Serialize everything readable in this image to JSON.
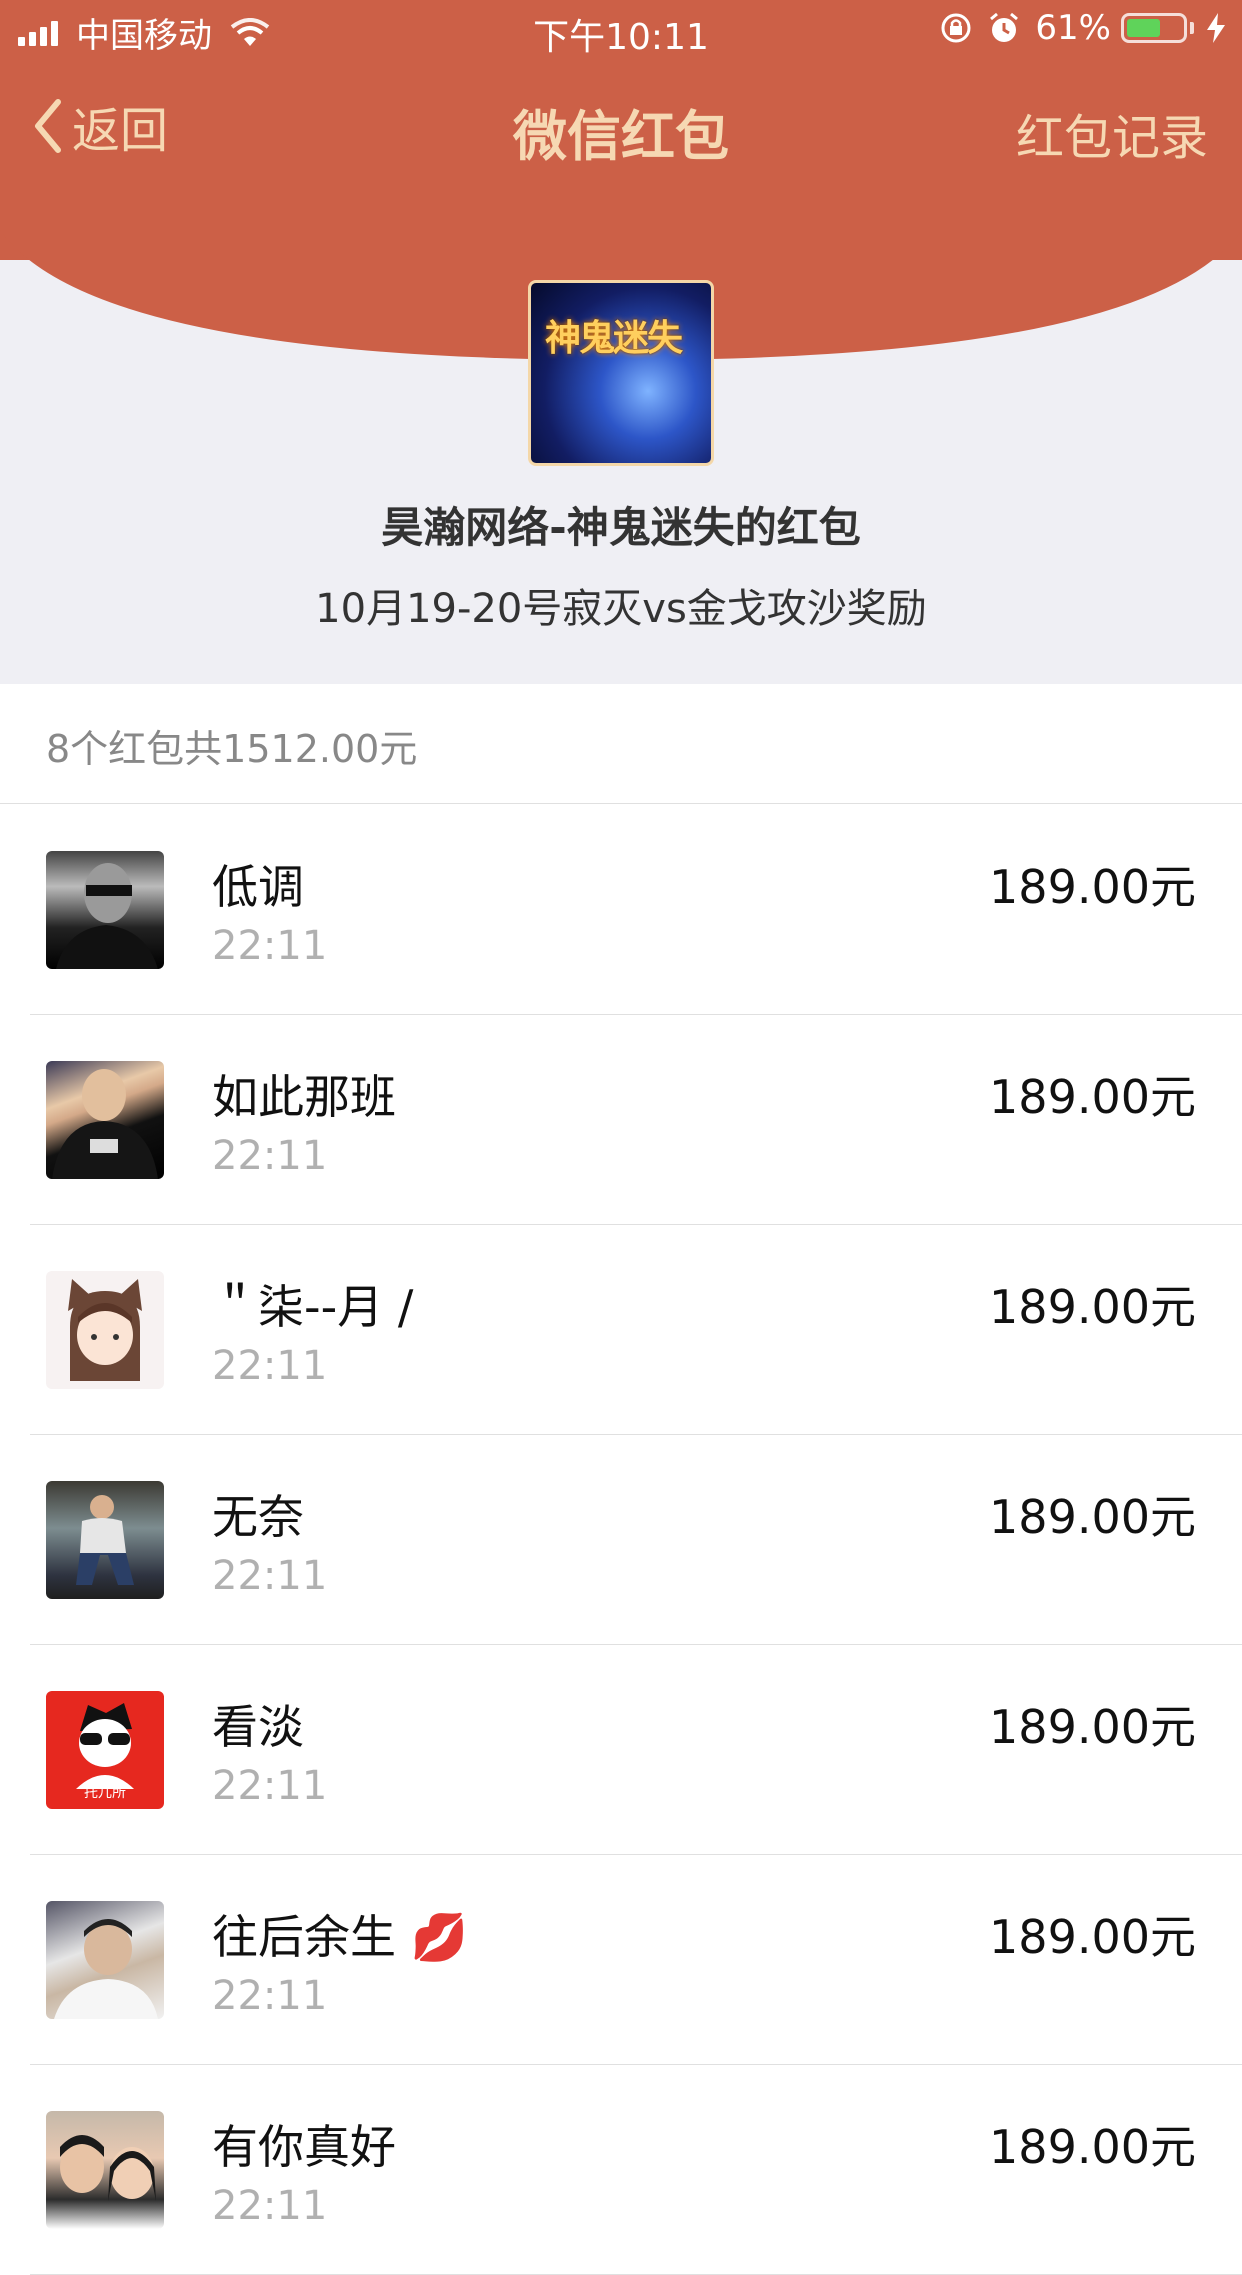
{
  "status_bar": {
    "carrier": "中国移动",
    "time": "下午10:11",
    "battery": "61%",
    "battery_level": 0.61
  },
  "nav": {
    "back_label": "返回",
    "title": "微信红包",
    "right_label": "红包记录"
  },
  "sender": {
    "avatar_text": "神鬼迷失",
    "name": "昊瀚网络-神鬼迷失的红包",
    "message": "10月19-20号寂灭vs金戈攻沙奖励"
  },
  "summary": "8个红包共1512.00元",
  "colors": {
    "header": "#cc6047",
    "header_text": "#f6d8b3",
    "background": "#efeff4"
  },
  "records": [
    {
      "name": "低调",
      "time": "22:11",
      "amount": "189.00元"
    },
    {
      "name": "如此那班",
      "time": "22:11",
      "amount": "189.00元"
    },
    {
      "name": "＂柒--月 /",
      "time": "22:11",
      "amount": "189.00元"
    },
    {
      "name": "无奈",
      "time": "22:11",
      "amount": "189.00元"
    },
    {
      "name": "看淡",
      "time": "22:11",
      "amount": "189.00元",
      "avatar_text": "托儿所"
    },
    {
      "name": "往后余生 💋",
      "time": "22:11",
      "amount": "189.00元"
    },
    {
      "name": "有你真好",
      "time": "22:11",
      "amount": "189.00元"
    }
  ]
}
